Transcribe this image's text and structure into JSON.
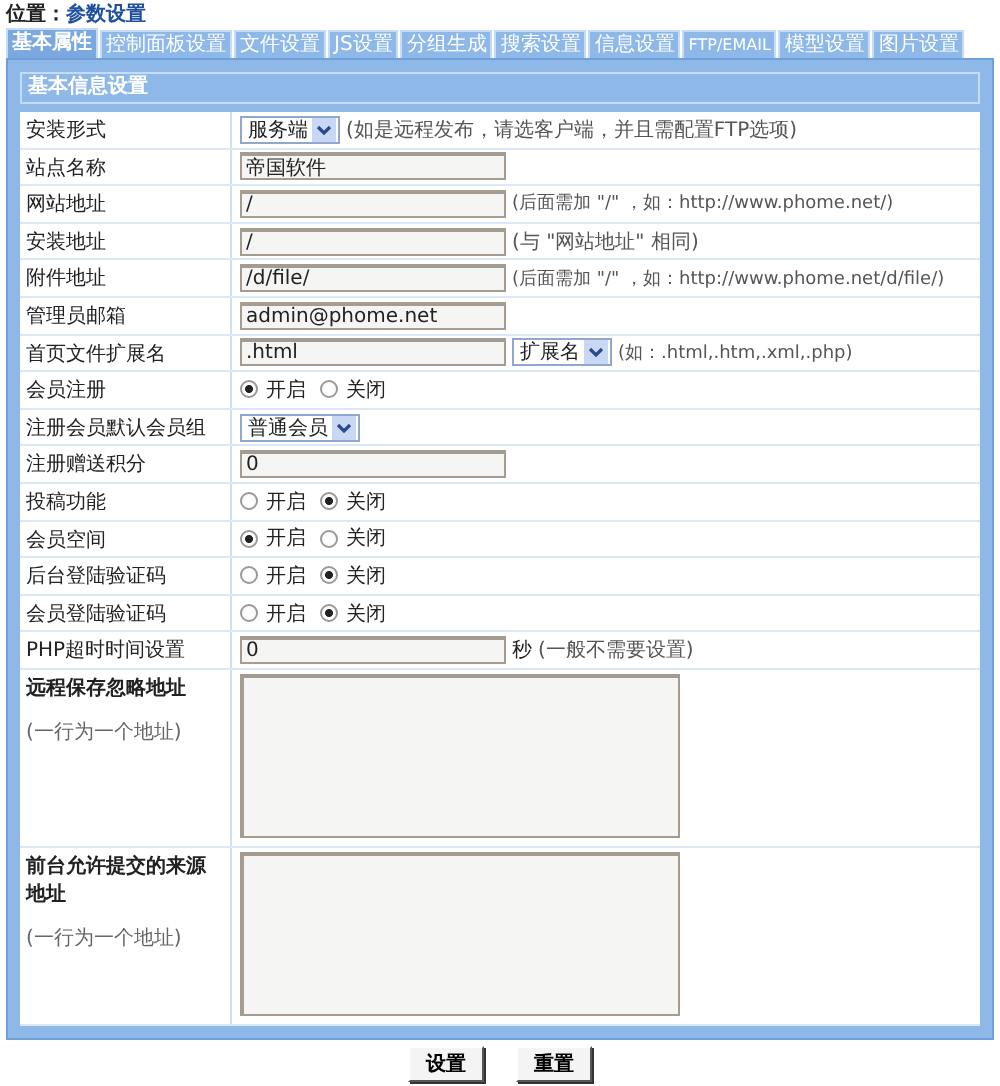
{
  "breadcrumb": {
    "label": "位置：",
    "link": "参数设置"
  },
  "tabs": [
    {
      "label": "基本属性",
      "selected": true
    },
    {
      "label": "控制面板设置",
      "selected": false
    },
    {
      "label": "文件设置",
      "selected": false
    },
    {
      "label": "JS设置",
      "selected": false
    },
    {
      "label": "分组生成",
      "selected": false
    },
    {
      "label": "搜索设置",
      "selected": false
    },
    {
      "label": "信息设置",
      "selected": false
    },
    {
      "label": "FTP/EMAIL",
      "selected": false
    },
    {
      "label": "模型设置",
      "selected": false
    },
    {
      "label": "图片设置",
      "selected": false
    }
  ],
  "section_title": "基本信息设置",
  "rows": [
    {
      "kind": "select",
      "label": "安装形式",
      "value": "服务端",
      "hint": "(如是远程发布，请选客户端，并且需配置FTP选项)"
    },
    {
      "kind": "text",
      "label": "站点名称",
      "value": "帝国软件"
    },
    {
      "kind": "text",
      "label": "网站地址",
      "value": "/",
      "hint": "(后面需加 \"/\" ，如：http://www.phome.net/)"
    },
    {
      "kind": "text",
      "label": "安装地址",
      "value": "/",
      "hint": "(与 \"网站地址\" 相同)"
    },
    {
      "kind": "text",
      "label": "附件地址",
      "value": "/d/file/",
      "hint": "(后面需加 \"/\" ，如：http://www.phome.net/d/file/)"
    },
    {
      "kind": "text",
      "label": "管理员邮箱",
      "value": "admin@phome.net"
    },
    {
      "kind": "text_select",
      "label": "首页文件扩展名",
      "value": ".html",
      "select": "扩展名",
      "hint": "(如：.html,.htm,.xml,.php)"
    },
    {
      "kind": "radio",
      "label": "会员注册",
      "options": [
        {
          "label": "开启",
          "selected": true
        },
        {
          "label": "关闭",
          "selected": false
        }
      ]
    },
    {
      "kind": "select",
      "label": "注册会员默认会员组",
      "value": "普通会员"
    },
    {
      "kind": "text",
      "label": "注册赠送积分",
      "value": "0"
    },
    {
      "kind": "radio",
      "label": "投稿功能",
      "options": [
        {
          "label": "开启",
          "selected": false
        },
        {
          "label": "关闭",
          "selected": true
        }
      ]
    },
    {
      "kind": "radio",
      "label": "会员空间",
      "options": [
        {
          "label": "开启",
          "selected": true
        },
        {
          "label": "关闭",
          "selected": false
        }
      ]
    },
    {
      "kind": "radio",
      "label": "后台登陆验证码",
      "options": [
        {
          "label": "开启",
          "selected": false
        },
        {
          "label": "关闭",
          "selected": true
        }
      ]
    },
    {
      "kind": "radio",
      "label": "会员登陆验证码",
      "options": [
        {
          "label": "开启",
          "selected": false
        },
        {
          "label": "关闭",
          "selected": true
        }
      ]
    },
    {
      "kind": "text",
      "label": "PHP超时时间设置",
      "value": "0",
      "unit": "秒",
      "hint": "(一般不需要设置)"
    },
    {
      "kind": "textarea",
      "label": "远程保存忽略地址",
      "note": "(一行为一个地址)"
    },
    {
      "kind": "textarea",
      "label": "前台允许提交的来源地址",
      "note": "(一行为一个地址)"
    }
  ],
  "buttons": [
    "设置",
    "重置"
  ]
}
